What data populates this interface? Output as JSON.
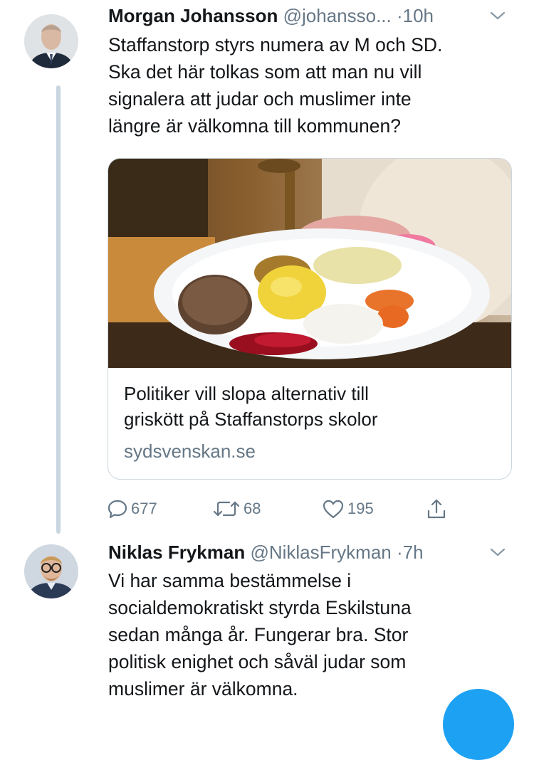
{
  "tweets": [
    {
      "name": "Morgan Johansson",
      "handle": "@johansso...",
      "separator": "·",
      "time": "10h",
      "lines": [
        "Staffanstorp styrs numera av M och SD.",
        "Ska det här tolkas som att man nu vill",
        "signalera att judar och muslimer inte",
        "längre är välkomna till kommunen?"
      ],
      "card": {
        "title_lines": [
          "Politiker vill slopa alternativ till",
          "griskött på Staffanstorps skolor"
        ],
        "domain": "sydsvenskan.se"
      },
      "actions": {
        "reply_count": "677",
        "retweet_count": "68",
        "like_count": "195"
      }
    },
    {
      "name": "Niklas Frykman",
      "handle": "@NiklasFrykman",
      "separator": "·",
      "time": "7h",
      "lines": [
        "Vi har samma bestämmelse i",
        "socialdemokratiskt styrda Eskilstuna",
        "sedan många år. Fungerar bra. Stor",
        "politisk enighet och såväl judar som",
        "muslimer är välkomna."
      ]
    }
  ],
  "colors": {
    "text": "#14171a",
    "secondary": "#657786",
    "thread_line": "#c8d6e0",
    "border": "#ccd6dd",
    "accent": "#1da1f2"
  }
}
